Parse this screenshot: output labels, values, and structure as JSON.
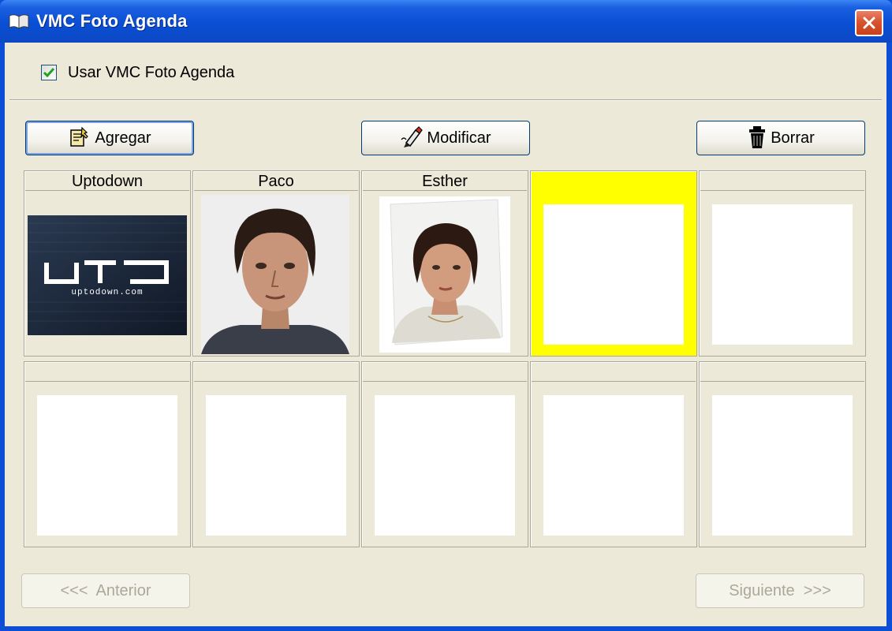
{
  "window": {
    "title": "VMC Foto Agenda",
    "icon": "book-icon",
    "close_icon": "close-icon"
  },
  "options": {
    "use_agenda_label": "Usar VMC Foto Agenda",
    "use_agenda_checked": true
  },
  "toolbar": {
    "add_label": "Agregar",
    "add_icon": "add-contact-icon",
    "edit_label": "Modificar",
    "edit_icon": "edit-pen-icon",
    "delete_label": "Borrar",
    "delete_icon": "trash-icon"
  },
  "contacts": [
    {
      "name": "Uptodown",
      "photo": "uptodown-logo"
    },
    {
      "name": "Paco",
      "photo": "portrait-man"
    },
    {
      "name": "Esther",
      "photo": "portrait-woman"
    },
    {
      "name": "",
      "photo": "empty",
      "selected": true
    },
    {
      "name": "",
      "photo": "empty"
    },
    {
      "name": "",
      "photo": "empty"
    },
    {
      "name": "",
      "photo": "empty"
    },
    {
      "name": "",
      "photo": "empty"
    },
    {
      "name": "",
      "photo": "empty"
    },
    {
      "name": "",
      "photo": "empty"
    }
  ],
  "logo_text": "uptodown.com",
  "colors": {
    "titlebar": "#0a4fd4",
    "selected_cell": "#ffff00",
    "dialog_bg": "#ece9d8"
  },
  "navigation": {
    "prev_label": "<<<  Anterior",
    "next_label": "Siguiente  >>>",
    "prev_enabled": false,
    "next_enabled": false
  }
}
